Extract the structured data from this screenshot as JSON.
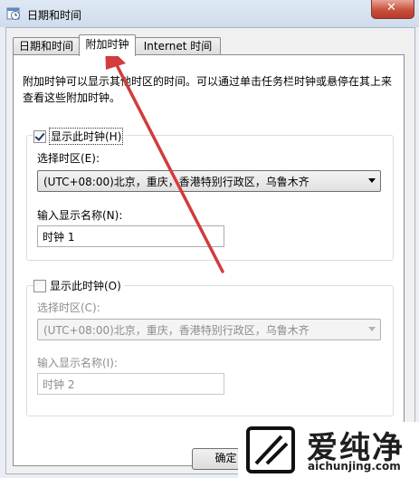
{
  "window": {
    "title": "日期和时间",
    "close_glyph": "✕"
  },
  "tabs": [
    {
      "label": "日期和时间"
    },
    {
      "label": "附加时钟"
    },
    {
      "label": "Internet 时间"
    }
  ],
  "description": "附加时钟可以显示其他时区的时间。可以通过单击任务栏时钟或悬停在其上来查看这些附加时钟。",
  "clock1": {
    "show_label": "显示此时钟(H)",
    "checked": true,
    "timezone_label": "选择时区(E):",
    "timezone_value": "(UTC+08:00)北京，重庆，香港特别行政区，乌鲁木齐",
    "name_label": "输入显示名称(N):",
    "name_value": "时钟 1"
  },
  "clock2": {
    "show_label": "显示此时钟(O)",
    "checked": false,
    "timezone_label": "选择时区(C):",
    "timezone_value": "(UTC+08:00)北京，重庆，香港特别行政区，乌鲁木齐",
    "name_label": "输入显示名称(I):",
    "name_value": "时钟 2"
  },
  "buttons": {
    "ok": "确定"
  },
  "watermark": {
    "brand": "爱纯净",
    "url": "aichunjing.com"
  },
  "colors": {
    "annotation_arrow": "#d23c3c",
    "close_button": "#c7503c"
  }
}
